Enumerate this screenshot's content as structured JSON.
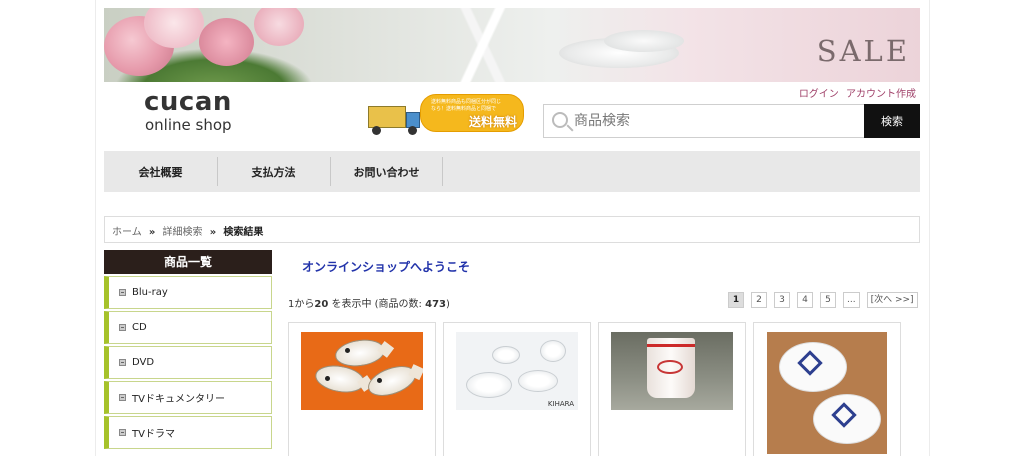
{
  "banner": {
    "text": "SALE"
  },
  "auth": {
    "login": "ログイン",
    "register": "アカウント作成"
  },
  "logo": {
    "line1": "cucan",
    "line2": "online shop"
  },
  "free_shipping": {
    "small": "送料無料商品も同梱区分が同じなら！送料無料商品と同梱で",
    "big": "送料無料"
  },
  "search": {
    "placeholder": "商品検索",
    "button": "検索"
  },
  "nav": {
    "items": [
      "会社概要",
      "支払方法",
      "お問い合わせ"
    ]
  },
  "breadcrumb": {
    "home": "ホーム",
    "advanced": "詳細検索",
    "current": "検索結果",
    "sep": "»"
  },
  "sidebar": {
    "title": "商品一覧",
    "categories": [
      "Blu-ray",
      "CD",
      "DVD",
      "TVドキュメンタリー",
      "TVドラマ"
    ]
  },
  "main": {
    "welcome": "オンラインショップへようこそ",
    "results": {
      "prefix": "1から",
      "to": "20",
      "mid": " を表示中 (商品の数: ",
      "total": "473",
      "suffix": ")"
    },
    "pager": [
      "1",
      "2",
      "3",
      "4",
      "5",
      "...",
      "[次へ >>]"
    ]
  },
  "products": {
    "brand_label": "KIHARA"
  },
  "colors": {
    "nav_bg": "#e8e8e8",
    "sidebar_title_bg": "#2b1f1b",
    "category_accent": "#a6c22a",
    "welcome_text": "#2233aa",
    "auth_link": "#a0426a"
  }
}
